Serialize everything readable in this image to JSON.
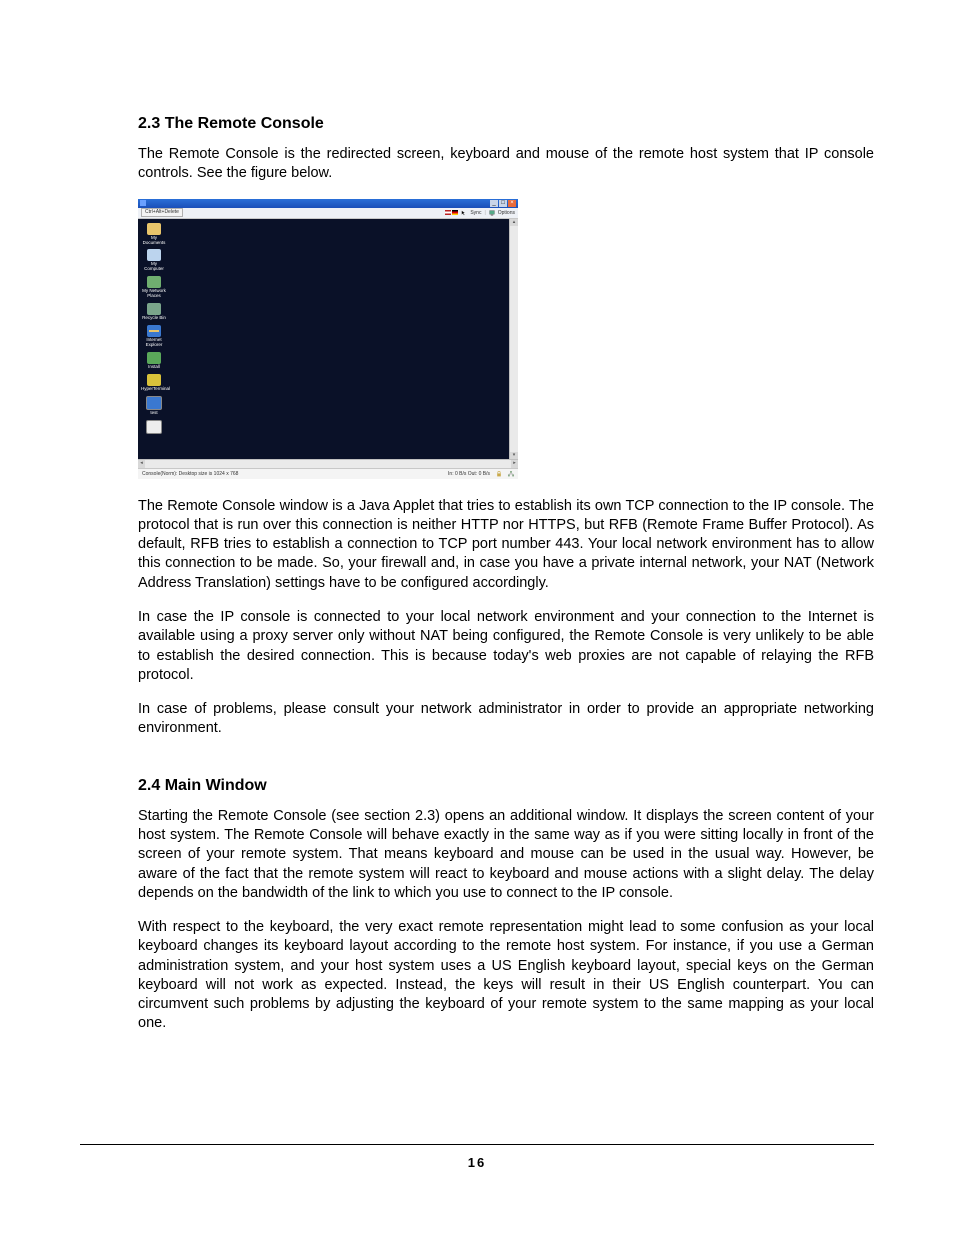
{
  "section1": {
    "heading": "2.3 The Remote Console",
    "p1": "The Remote Console is the redirected screen, keyboard and mouse of the remote host system that IP console controls. See the figure below.",
    "p2": "The Remote Console window is a Java Applet that tries to establish its own TCP connection to the IP console. The protocol that is run over this connection is neither HTTP nor HTTPS, but RFB (Remote Frame Buffer Protocol). As default, RFB tries to establish a connection to TCP port number 443. Your local network environment has to allow this connection to be made. So, your firewall and, in case you have a private internal network, your NAT (Network Address Translation) settings have to be configured accordingly.",
    "p3": "In case the IP console is connected to your local network environment and your connection to the Internet is available using a proxy server only without NAT being configured, the Remote Console is very unlikely to be able to establish the desired connection. This is because today's web proxies are not capable of relaying the RFB protocol.",
    "p4": "In case of problems, please consult your network administrator in order to provide an appropriate networking environment."
  },
  "section2": {
    "heading": "2.4 Main Window",
    "p1": "Starting the Remote Console (see section 2.3) opens an additional window. It displays the screen content of your host system. The Remote Console will behave exactly in the same way as if you were sitting locally in front of the screen of your remote system. That means keyboard and mouse can be used in the usual way. However, be aware of the fact that the remote system will react to keyboard and mouse actions with a slight delay. The delay depends on the bandwidth of the link to which you use to connect to the IP console.",
    "p2": "With respect to the keyboard, the very exact remote representation might lead to some confusion as your local keyboard changes its keyboard layout according to the remote host system. For instance, if you use a German administration system, and your host system uses a US English keyboard layout, special keys on the German keyboard will not work as expected. Instead, the keys will result in their US English counterpart. You can circumvent such problems by adjusting the keyboard of your remote system to the same mapping as your local one."
  },
  "figure": {
    "toolbar_button": "Ctrl+Alt+Delete",
    "toolbar_sync": "Sync",
    "toolbar_options": "Options",
    "status_left": "Console(Norm): Desktop size is 1024 x 768",
    "status_right": "In: 0 B/s  Out: 0 B/s",
    "icons": [
      {
        "cls": "ic-folder",
        "label": "My Documents"
      },
      {
        "cls": "ic-pc",
        "label": "My Computer"
      },
      {
        "cls": "ic-net",
        "label": "My Network Places"
      },
      {
        "cls": "ic-bin",
        "label": "Recycle Bin"
      },
      {
        "cls": "ic-ie",
        "label": "Internet Explorer"
      },
      {
        "cls": "ic-round",
        "label": "Install"
      },
      {
        "cls": "ic-gear",
        "label": "HyperTerminal"
      },
      {
        "cls": "ic-mon",
        "label": "test"
      },
      {
        "cls": "ic-doc",
        "label": ""
      }
    ]
  },
  "page_number": "16"
}
